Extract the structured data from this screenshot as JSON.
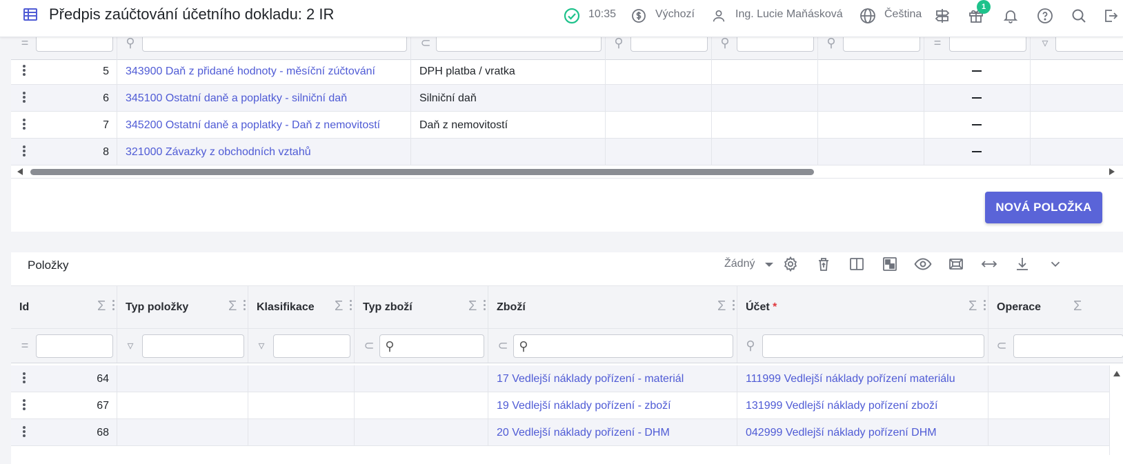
{
  "header": {
    "title": "Předpis zaúčtování účetního dokladu: 2 IR",
    "time": "10:35",
    "currency": "Výchozí",
    "user": "Ing. Lucie Maňásková",
    "language": "Čeština",
    "notification_count": "1"
  },
  "upper_table": {
    "rows": [
      {
        "num": "5",
        "account": "343900 Daň z přidané hodnoty - měsíční zúčtování",
        "text": "DPH platba / vratka"
      },
      {
        "num": "6",
        "account": "345100 Ostatní daně a poplatky - silniční daň",
        "text": "Silniční daň"
      },
      {
        "num": "7",
        "account": "345200 Ostatní daně a poplatky - Daň z nemovitostí",
        "text": "Daň z nemovitostí"
      },
      {
        "num": "8",
        "account": "321000 Závazky z obchodních vztahů",
        "text": ""
      }
    ],
    "new_item_label": "NOVÁ POLOŽKA"
  },
  "items": {
    "title": "Položky",
    "view_select": "Žádný",
    "columns": {
      "id": "Id",
      "type": "Typ položky",
      "class": "Klasifikace",
      "goods_type": "Typ zboží",
      "goods": "Zboží",
      "account": "Účet",
      "account_required": "*",
      "operation": "Operace"
    },
    "rows": [
      {
        "id": "64",
        "goods": "17 Vedlejší náklady pořízení - materiál",
        "account": "111999 Vedlejší náklady pořízení materiálu"
      },
      {
        "id": "67",
        "goods": "19 Vedlejší náklady pořízení - zboží",
        "account": "131999 Vedlejší náklady pořízení zboží"
      },
      {
        "id": "68",
        "goods": "20 Vedlejší náklady pořízení - DHM",
        "account": "042999 Vedlejší náklady pořízení DHM"
      }
    ]
  },
  "colors": {
    "accent": "#5a64d8",
    "link": "#4f5bd5",
    "success": "#1ec28b"
  },
  "icons": [
    "table-icon",
    "check-circle-icon",
    "dollar-gear-icon",
    "user-icon",
    "globe-icon",
    "signpost-icon",
    "gift-icon",
    "bell-icon",
    "help-icon",
    "search-icon",
    "logout-icon",
    "settings-icon",
    "delete-icon",
    "columns-icon",
    "layout-icon",
    "eye-icon",
    "fit-icon",
    "expand-width-icon",
    "download-icon",
    "chevron-down-icon"
  ]
}
